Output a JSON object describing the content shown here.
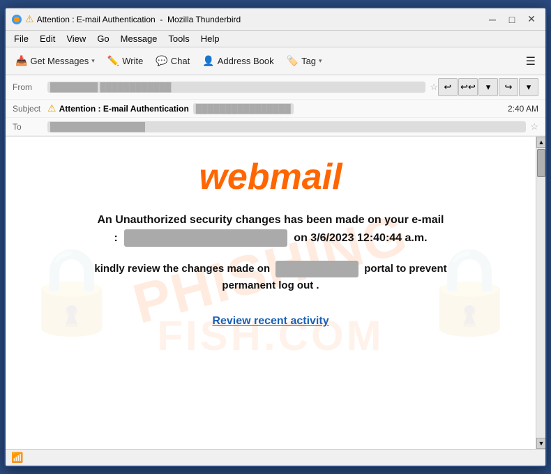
{
  "window": {
    "title_warning": "⚠",
    "title_main": "Attention : E-mail Authentication",
    "title_app": "Mozilla Thunderbird",
    "btn_minimize": "─",
    "btn_maximize": "□",
    "btn_close": "✕"
  },
  "menubar": {
    "items": [
      "File",
      "Edit",
      "View",
      "Go",
      "Message",
      "Tools",
      "Help"
    ]
  },
  "toolbar": {
    "get_messages": "Get Messages",
    "write": "Write",
    "chat": "Chat",
    "address_book": "Address Book",
    "tag": "Tag",
    "dropdown": "▾",
    "menu_icon": "☰"
  },
  "email": {
    "from_label": "From",
    "from_value": "████████ ████████████",
    "subject_label": "Subject",
    "subject_warning": "⚠",
    "subject_text": "Attention : E-mail Authentication",
    "subject_email_blurred": "████████████████",
    "time": "2:40 AM",
    "to_label": "To",
    "to_value": "████████████████"
  },
  "nav_buttons": {
    "back": "↩",
    "reply": "↩↩",
    "dropdown": "▾",
    "forward": "↪",
    "more": "▾"
  },
  "content": {
    "webmail_title": "webmail",
    "main_line1": "An Unauthorized security changes has been made on your e-mail",
    "main_line2_prefix": ":",
    "main_line2_blurred": "████████████████████",
    "main_line2_suffix": "on 3/6/2023 12:40:44 a.m.",
    "secondary_line1_prefix": "kindly review the changes made on",
    "secondary_blurred": "██████ ████",
    "secondary_line1_suffix": "portal to prevent",
    "secondary_line2": "permanent log out .",
    "review_link": "Review recent activity",
    "watermark": "PHISHING",
    "watermark_bottom": "FISH.COM"
  },
  "statusbar": {
    "icon": "📶"
  }
}
